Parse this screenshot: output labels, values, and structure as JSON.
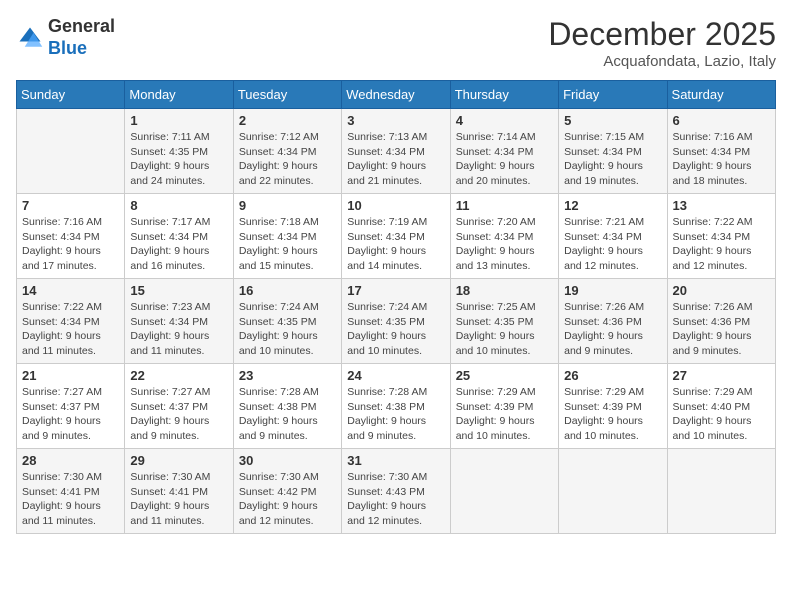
{
  "logo": {
    "general": "General",
    "blue": "Blue"
  },
  "header": {
    "month": "December 2025",
    "location": "Acquafondata, Lazio, Italy"
  },
  "days_of_week": [
    "Sunday",
    "Monday",
    "Tuesday",
    "Wednesday",
    "Thursday",
    "Friday",
    "Saturday"
  ],
  "weeks": [
    [
      {
        "day": "",
        "info": ""
      },
      {
        "day": "1",
        "info": "Sunrise: 7:11 AM\nSunset: 4:35 PM\nDaylight: 9 hours\nand 24 minutes."
      },
      {
        "day": "2",
        "info": "Sunrise: 7:12 AM\nSunset: 4:34 PM\nDaylight: 9 hours\nand 22 minutes."
      },
      {
        "day": "3",
        "info": "Sunrise: 7:13 AM\nSunset: 4:34 PM\nDaylight: 9 hours\nand 21 minutes."
      },
      {
        "day": "4",
        "info": "Sunrise: 7:14 AM\nSunset: 4:34 PM\nDaylight: 9 hours\nand 20 minutes."
      },
      {
        "day": "5",
        "info": "Sunrise: 7:15 AM\nSunset: 4:34 PM\nDaylight: 9 hours\nand 19 minutes."
      },
      {
        "day": "6",
        "info": "Sunrise: 7:16 AM\nSunset: 4:34 PM\nDaylight: 9 hours\nand 18 minutes."
      }
    ],
    [
      {
        "day": "7",
        "info": "Sunrise: 7:16 AM\nSunset: 4:34 PM\nDaylight: 9 hours\nand 17 minutes."
      },
      {
        "day": "8",
        "info": "Sunrise: 7:17 AM\nSunset: 4:34 PM\nDaylight: 9 hours\nand 16 minutes."
      },
      {
        "day": "9",
        "info": "Sunrise: 7:18 AM\nSunset: 4:34 PM\nDaylight: 9 hours\nand 15 minutes."
      },
      {
        "day": "10",
        "info": "Sunrise: 7:19 AM\nSunset: 4:34 PM\nDaylight: 9 hours\nand 14 minutes."
      },
      {
        "day": "11",
        "info": "Sunrise: 7:20 AM\nSunset: 4:34 PM\nDaylight: 9 hours\nand 13 minutes."
      },
      {
        "day": "12",
        "info": "Sunrise: 7:21 AM\nSunset: 4:34 PM\nDaylight: 9 hours\nand 12 minutes."
      },
      {
        "day": "13",
        "info": "Sunrise: 7:22 AM\nSunset: 4:34 PM\nDaylight: 9 hours\nand 12 minutes."
      }
    ],
    [
      {
        "day": "14",
        "info": "Sunrise: 7:22 AM\nSunset: 4:34 PM\nDaylight: 9 hours\nand 11 minutes."
      },
      {
        "day": "15",
        "info": "Sunrise: 7:23 AM\nSunset: 4:34 PM\nDaylight: 9 hours\nand 11 minutes."
      },
      {
        "day": "16",
        "info": "Sunrise: 7:24 AM\nSunset: 4:35 PM\nDaylight: 9 hours\nand 10 minutes."
      },
      {
        "day": "17",
        "info": "Sunrise: 7:24 AM\nSunset: 4:35 PM\nDaylight: 9 hours\nand 10 minutes."
      },
      {
        "day": "18",
        "info": "Sunrise: 7:25 AM\nSunset: 4:35 PM\nDaylight: 9 hours\nand 10 minutes."
      },
      {
        "day": "19",
        "info": "Sunrise: 7:26 AM\nSunset: 4:36 PM\nDaylight: 9 hours\nand 9 minutes."
      },
      {
        "day": "20",
        "info": "Sunrise: 7:26 AM\nSunset: 4:36 PM\nDaylight: 9 hours\nand 9 minutes."
      }
    ],
    [
      {
        "day": "21",
        "info": "Sunrise: 7:27 AM\nSunset: 4:37 PM\nDaylight: 9 hours\nand 9 minutes."
      },
      {
        "day": "22",
        "info": "Sunrise: 7:27 AM\nSunset: 4:37 PM\nDaylight: 9 hours\nand 9 minutes."
      },
      {
        "day": "23",
        "info": "Sunrise: 7:28 AM\nSunset: 4:38 PM\nDaylight: 9 hours\nand 9 minutes."
      },
      {
        "day": "24",
        "info": "Sunrise: 7:28 AM\nSunset: 4:38 PM\nDaylight: 9 hours\nand 9 minutes."
      },
      {
        "day": "25",
        "info": "Sunrise: 7:29 AM\nSunset: 4:39 PM\nDaylight: 9 hours\nand 10 minutes."
      },
      {
        "day": "26",
        "info": "Sunrise: 7:29 AM\nSunset: 4:39 PM\nDaylight: 9 hours\nand 10 minutes."
      },
      {
        "day": "27",
        "info": "Sunrise: 7:29 AM\nSunset: 4:40 PM\nDaylight: 9 hours\nand 10 minutes."
      }
    ],
    [
      {
        "day": "28",
        "info": "Sunrise: 7:30 AM\nSunset: 4:41 PM\nDaylight: 9 hours\nand 11 minutes."
      },
      {
        "day": "29",
        "info": "Sunrise: 7:30 AM\nSunset: 4:41 PM\nDaylight: 9 hours\nand 11 minutes."
      },
      {
        "day": "30",
        "info": "Sunrise: 7:30 AM\nSunset: 4:42 PM\nDaylight: 9 hours\nand 12 minutes."
      },
      {
        "day": "31",
        "info": "Sunrise: 7:30 AM\nSunset: 4:43 PM\nDaylight: 9 hours\nand 12 minutes."
      },
      {
        "day": "",
        "info": ""
      },
      {
        "day": "",
        "info": ""
      },
      {
        "day": "",
        "info": ""
      }
    ]
  ]
}
